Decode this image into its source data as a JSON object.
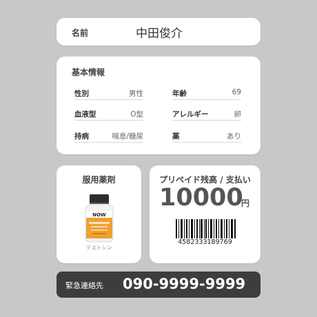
{
  "name_card": {
    "label": "名前",
    "value": "中田俊介"
  },
  "info": {
    "title": "基本情報",
    "fields": [
      {
        "label": "性別",
        "value": "男性"
      },
      {
        "label": "年齢",
        "value": "69"
      },
      {
        "label": "血液型",
        "value": "O型"
      },
      {
        "label": "アレルギー",
        "value": "卵"
      },
      {
        "label": "持病",
        "value": "喘息/糖尿"
      },
      {
        "label": "薬",
        "value": "あり"
      }
    ]
  },
  "medication": {
    "title": "服用薬剤",
    "caption": "テストシン",
    "bottle_brand": "NOW"
  },
  "prepaid": {
    "title": "プリペイド残高 / 支払い",
    "amount": "10000",
    "currency": "円",
    "barcode_number": "4582333189769"
  },
  "emergency": {
    "label": "緊急連絡先",
    "number": "090-9999-9999"
  },
  "colors": {
    "background": "#c8c8c8",
    "card": "#ffffff",
    "emergency_bar": "#3d3d3d",
    "bottle_cap": "#333333",
    "bottle_body": "#f0a030"
  }
}
